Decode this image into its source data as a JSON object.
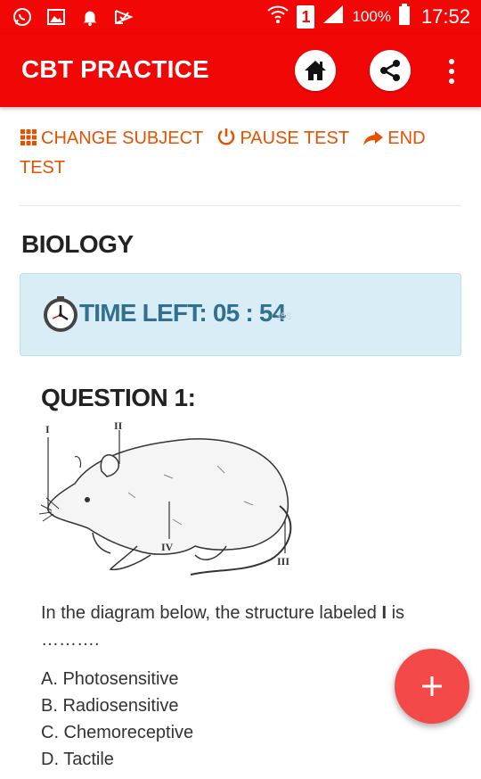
{
  "status_bar": {
    "sim": "1",
    "battery": "100%",
    "time": "17:52"
  },
  "app_bar": {
    "title": "CBT PRACTICE"
  },
  "actions": {
    "change_subject": "CHANGE SUBJECT",
    "pause_test": "PAUSE TEST",
    "end_test": "END TEST"
  },
  "subject": "BIOLOGY",
  "timer": {
    "label": "TIME LEFT: 05 : 54",
    "seconds_small": "355"
  },
  "question": {
    "title": "QUESTION 1:",
    "text_before": "In the diagram below, the structure labeled ",
    "label_bold": "I",
    "text_after": " is ……….",
    "diagram_labels": [
      "I",
      "II",
      "IV",
      "III"
    ],
    "options": [
      "A. Photosensitive",
      "B. Radiosensitive",
      "C. Chemoreceptive",
      "D. Tactile"
    ]
  },
  "colors": {
    "primary": "#f20707",
    "accent_link": "#e65100",
    "timer_bg": "#d9edf7",
    "timer_text": "#31708f",
    "fab": "#f44949"
  }
}
